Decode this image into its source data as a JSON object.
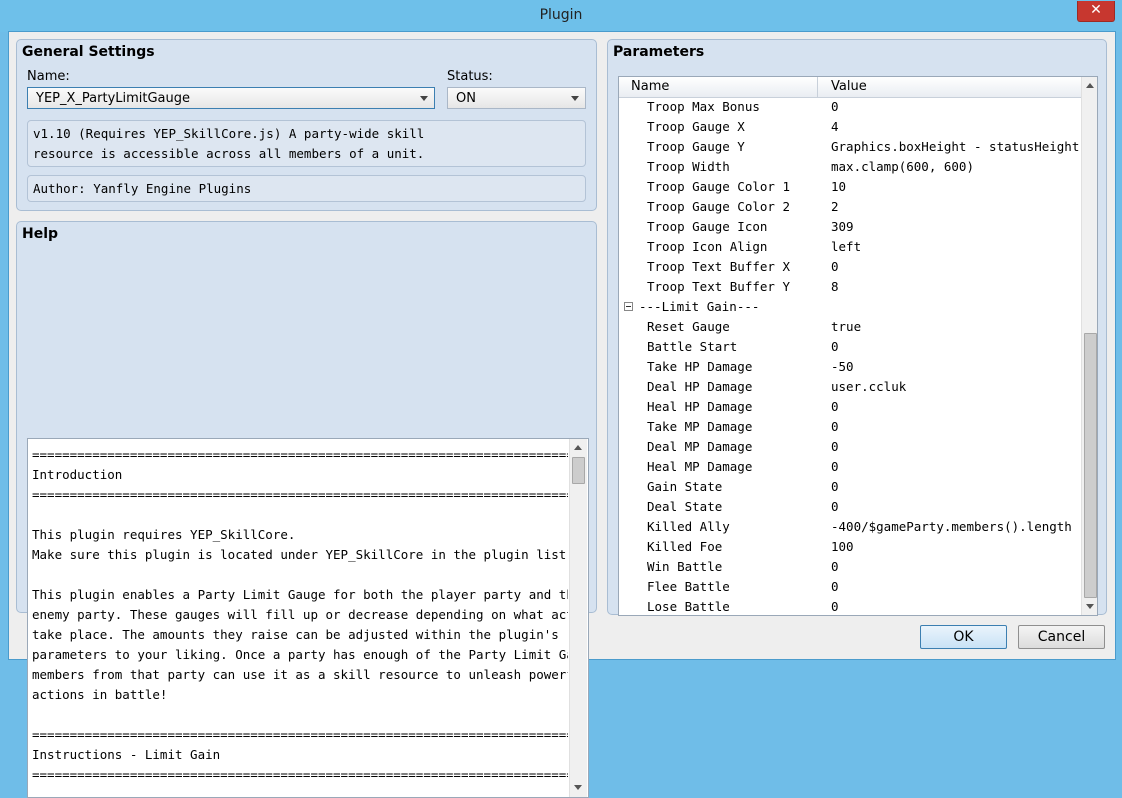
{
  "window": {
    "title": "Plugin",
    "close_glyph": "✕"
  },
  "general": {
    "title": "General Settings",
    "name_label": "Name:",
    "name_value": "YEP_X_PartyLimitGauge",
    "status_label": "Status:",
    "status_value": "ON",
    "description": "v1.10 (Requires YEP_SkillCore.js) A party-wide skill\nresource is accessible across all members of a unit.",
    "author": "Author: Yanfly Engine Plugins"
  },
  "help": {
    "title": "Help",
    "lines": [
      "==========================================================================",
      "Introduction",
      "==========================================================================",
      "",
      "This plugin requires YEP_SkillCore.",
      "Make sure this plugin is located under YEP_SkillCore in the plugin list.",
      "",
      "This plugin enables a Party Limit Gauge for both the player party and the",
      "enemy party. These gauges will fill up or decrease depending on what actions",
      "take place. The amounts they raise can be adjusted within the plugin's",
      "parameters to your liking. Once a party has enough of the Party Limit Gauge,",
      "members from that party can use it as a skill resource to unleash powerful",
      "actions in battle!",
      "",
      "==========================================================================",
      "Instructions - Limit Gain",
      "=========================================================================="
    ]
  },
  "parameters": {
    "title": "Parameters",
    "col_name": "Name",
    "col_value": "Value",
    "rows": [
      {
        "name": "Troop Max Bonus",
        "value": "0"
      },
      {
        "name": "Troop Gauge X",
        "value": "4"
      },
      {
        "name": "Troop Gauge Y",
        "value": "Graphics.boxHeight - statusHeight …"
      },
      {
        "name": "Troop Width",
        "value": "max.clamp(600, 600)"
      },
      {
        "name": "Troop Gauge Color 1",
        "value": "10"
      },
      {
        "name": "Troop Gauge Color 2",
        "value": "2"
      },
      {
        "name": "Troop Gauge Icon",
        "value": "309"
      },
      {
        "name": "Troop Icon Align",
        "value": "left"
      },
      {
        "name": "Troop Text Buffer X",
        "value": "0"
      },
      {
        "name": "Troop Text Buffer Y",
        "value": "8"
      },
      {
        "name": "---Limit Gain---",
        "value": "",
        "group": true
      },
      {
        "name": "Reset Gauge",
        "value": "true"
      },
      {
        "name": "Battle Start",
        "value": "0"
      },
      {
        "name": "Take HP Damage",
        "value": "-50"
      },
      {
        "name": "Deal HP Damage",
        "value": "user.ccluk"
      },
      {
        "name": "Heal HP Damage",
        "value": "0"
      },
      {
        "name": "Take MP Damage",
        "value": "0"
      },
      {
        "name": "Deal MP Damage",
        "value": "0"
      },
      {
        "name": "Heal MP Damage",
        "value": "0"
      },
      {
        "name": "Gain State",
        "value": "0"
      },
      {
        "name": "Deal State",
        "value": "0"
      },
      {
        "name": "Killed Ally",
        "value": "-400/$gameParty.members().length"
      },
      {
        "name": "Killed Foe",
        "value": "100"
      },
      {
        "name": "Win Battle",
        "value": "0"
      },
      {
        "name": "Flee Battle",
        "value": "0"
      },
      {
        "name": "Lose Battle",
        "value": "0"
      }
    ]
  },
  "buttons": {
    "ok": "OK",
    "cancel": "Cancel"
  }
}
